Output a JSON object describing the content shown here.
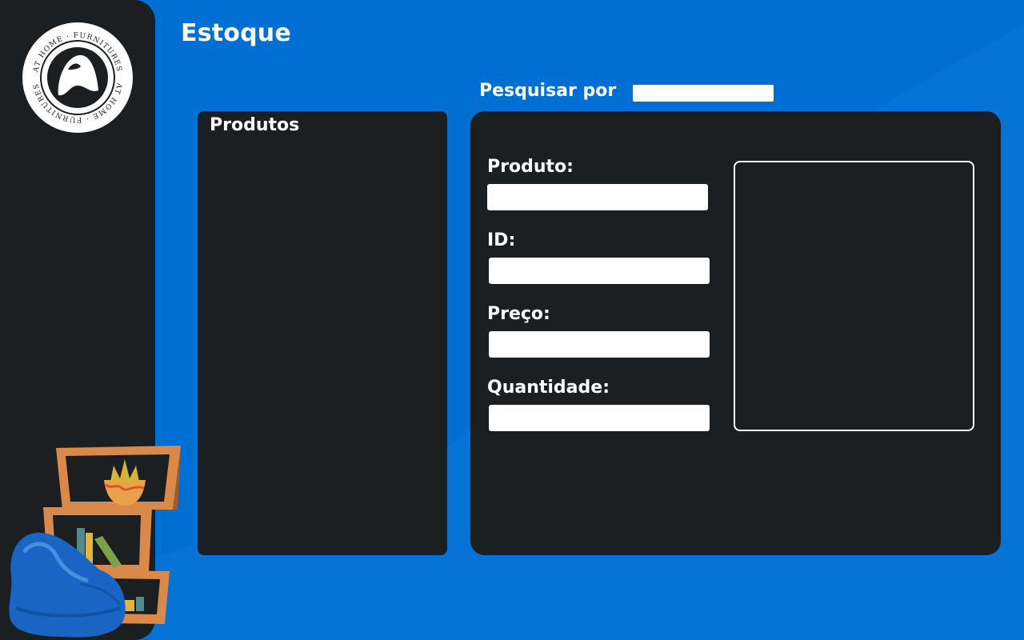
{
  "app": {
    "title": "Estoque",
    "logo_text": "AT HOME · FURNITURES",
    "logo_text_bottom": "AT HOME · FURNITURES"
  },
  "search": {
    "label": "Pesquisar por",
    "value": "",
    "placeholder": ""
  },
  "products": {
    "title": "Produtos",
    "items": []
  },
  "details": {
    "fields": [
      {
        "label": "Produto:",
        "value": ""
      },
      {
        "label": "ID:",
        "value": ""
      },
      {
        "label": "Preço:",
        "value": ""
      },
      {
        "label": "Quantidade:",
        "value": ""
      }
    ]
  },
  "colors": {
    "background": "#006fd3",
    "panel": "#1c1f22",
    "text": "#ffffff",
    "shelf": "#d9894a",
    "beanbag": "#1a64c4"
  },
  "icons": {
    "logo": "at-home-furnitures-logo",
    "decoration": "bookshelf-beanbag-illustration"
  }
}
